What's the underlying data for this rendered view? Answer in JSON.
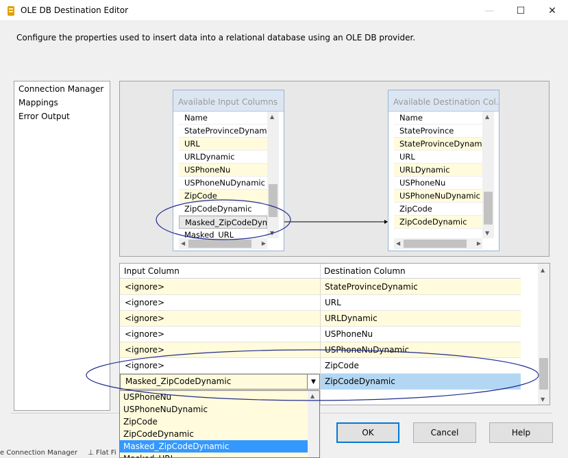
{
  "window": {
    "title": "OLE DB Destination Editor",
    "minimize": "—",
    "maximize": "☐",
    "close": "✕"
  },
  "description": "Configure the properties used to insert data into a relational database using an OLE DB provider.",
  "nav": {
    "items": [
      "Connection Manager",
      "Mappings",
      "Error Output"
    ]
  },
  "input_columns": {
    "title": "Available Input Columns",
    "header": "Name",
    "rows": [
      "StateProvinceDynamic",
      "URL",
      "URLDynamic",
      "USPhoneNu",
      "USPhoneNuDynamic",
      "ZipCode",
      "ZipCodeDynamic",
      "Masked_ZipCodeDyn...",
      "Masked_URL"
    ]
  },
  "destination_columns": {
    "title": "Available Destination Col...",
    "header": "Name",
    "rows": [
      "StateProvince",
      "StateProvinceDynamic",
      "URL",
      "URLDynamic",
      "USPhoneNu",
      "USPhoneNuDynamic",
      "ZipCode",
      "ZipCodeDynamic"
    ]
  },
  "grid": {
    "headers": [
      "Input Column",
      "Destination Column"
    ],
    "rows": [
      {
        "input": "<ignore>",
        "dest": "StateProvinceDynamic"
      },
      {
        "input": "<ignore>",
        "dest": "URL"
      },
      {
        "input": "<ignore>",
        "dest": "URLDynamic"
      },
      {
        "input": "<ignore>",
        "dest": "USPhoneNu"
      },
      {
        "input": "<ignore>",
        "dest": "USPhoneNuDynamic"
      },
      {
        "input": "<ignore>",
        "dest": "ZipCode"
      }
    ],
    "editing_row": {
      "input": "Masked_ZipCodeDynamic",
      "dest": "ZipCodeDynamic"
    }
  },
  "dropdown": {
    "options": [
      "USPhoneNu",
      "USPhoneNuDynamic",
      "ZipCode",
      "ZipCodeDynamic",
      "Masked_ZipCodeDynamic",
      "Masked_URL"
    ],
    "highlighted": "Masked_ZipCodeDynamic"
  },
  "buttons": {
    "ok": "OK",
    "cancel": "Cancel",
    "help": "Help"
  },
  "statusbar": {
    "left_text": "e Connection Manager",
    "right_text": "Flat File"
  },
  "colors": {
    "accent": "#0078d7",
    "row_alt": "#fffbdc",
    "selection": "#3399ff",
    "annotation": "#1f2a8c"
  }
}
